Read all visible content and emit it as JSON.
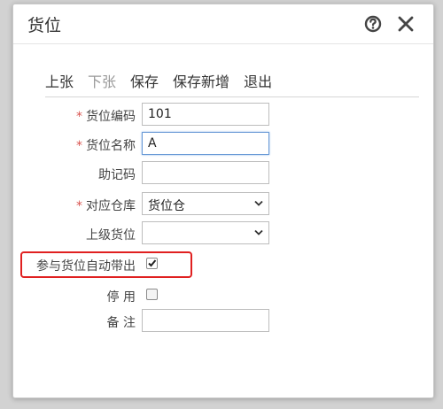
{
  "dialog": {
    "title": "货位",
    "help_icon": "help-circle-icon",
    "close_icon": "close-icon"
  },
  "toolbar": {
    "prev_label": "上张",
    "next_label": "下张",
    "save_label": "保存",
    "save_new_label": "保存新增",
    "exit_label": "退出"
  },
  "form": {
    "code": {
      "label": "货位编码",
      "value": "101",
      "required": true
    },
    "name": {
      "label": "货位名称",
      "value": "A",
      "required": true
    },
    "mnemonic": {
      "label": "助记码",
      "value": ""
    },
    "warehouse": {
      "label": "对应仓库",
      "value": "货位仓",
      "required": true
    },
    "parent": {
      "label": "上级货位",
      "value": ""
    },
    "auto_bring": {
      "label": "参与货位自动带出",
      "checked": true
    },
    "disabled": {
      "label": "停 用",
      "checked": false
    },
    "remark": {
      "label": "备 注",
      "value": ""
    }
  },
  "required_mark": "*",
  "colors": {
    "required": "#d9534f",
    "highlight": "#e02020",
    "focus_border": "#6a9ad6"
  }
}
